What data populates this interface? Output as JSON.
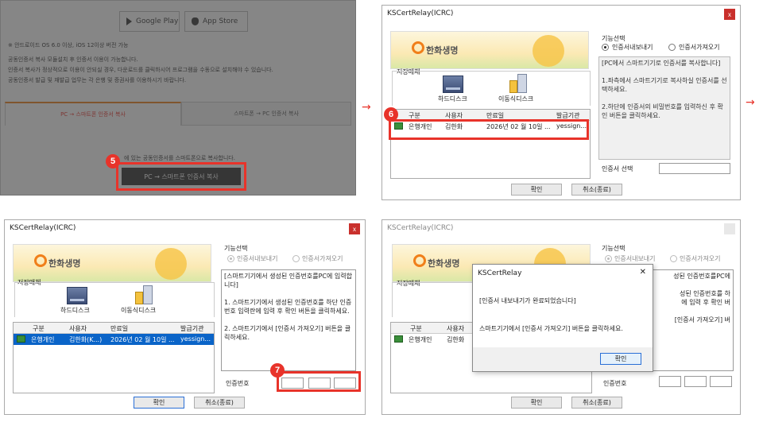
{
  "panel1": {
    "store_buttons": [
      "Google Play",
      "App Store"
    ],
    "os_note": "※ 안드로이드 OS 6.0 이상, iOS 12이상 버전 가능",
    "notes": [
      "공동인증서 복사 모듈설치 후 인증서 이용이 가능합니다.",
      "인증서 복사가 정상적으로 이용이 안되실 경우, 다운로드를 클릭하시어 프로그램을 수동으로 설치해야 수 있습니다.",
      "공동인증서 발급 및 재발급 업무는 각 은행 및 증권사를 이용하시기 바랍니다."
    ],
    "tab_pc_to_phone": "PC → 스마트폰 인증서 복사",
    "tab_phone_to_pc": "스마트폰 → PC 인증서 복사",
    "desc": "에 있는 공동인증서를 스마트폰으로 복사합니다.",
    "copy_button": "PC → 스마트폰 인증서 복사",
    "step": "5"
  },
  "win2": {
    "title": "KSCertRelay(ICRC)",
    "close": "x",
    "logo": "한화생명",
    "storage_label": "저장매체",
    "hdd": "하드디스크",
    "usb": "이동식디스크",
    "table_headers": [
      "구분",
      "사용자",
      "만료일",
      "발급기관"
    ],
    "row": [
      "은행개인",
      "김한화",
      "2026년 02 월 10일 ...",
      "yessign..."
    ],
    "func_label": "기능선택",
    "radio_export": "인증서내보내기",
    "radio_import": "인증서가져오기",
    "instructions": "[PC에서 스마트기기로 인증서를 복사합니다]\n\n1.좌측에서 스마트기기로 복사하실 인증서를 선택하세요.\n\n2.하단에 인증서의 비밀번호를 입력하신 후 확인 버튼을 클릭하세요.",
    "cert_select_label": "인증서 선택",
    "ok": "확인",
    "cancel": "취소(종료)",
    "step": "6"
  },
  "win3": {
    "title": "KSCertRelay(ICRC)",
    "close": "x",
    "logo": "한화생명",
    "storage_label": "저장매체",
    "hdd": "하드디스크",
    "usb": "이동식디스크",
    "table_headers": [
      "구분",
      "사용자",
      "만료일",
      "발급기관"
    ],
    "row": [
      "은행개인",
      "김한화(K...)",
      "2026년 02 월 10일 ...",
      "yessign..."
    ],
    "func_label": "기능선택",
    "radio_export": "인증서내보내기",
    "radio_import": "인증서가져오기",
    "instructions": "[스마트기기에서 생성된 인증번호를PC에 입력합니다]\n\n1. 스마트기기에서 생성된 인증번호를 하단 인증번호 입력란에 입력 후 확인 버튼을 클릭하세요.\n\n2. 스마트기기에서 [인증서 가져오기] 버튼을 클릭하세요.",
    "auth_label": "인증번호",
    "ok": "확인",
    "cancel": "취소(종료)",
    "step": "7"
  },
  "win4": {
    "title": "KSCertRelay(ICRC)",
    "logo": "한화생명",
    "storage_label": "저장매체",
    "table_headers": [
      "구분",
      "사용자"
    ],
    "row": [
      "은행개인",
      "김한화"
    ],
    "func_label": "기능선택",
    "radio_export": "인증서내보내기",
    "radio_import": "인증서가져오기",
    "instructions": "성된 인증번호를PC에\n\n성된 인증번호를 하\n에 입력 후 확인 버\n\n[인증서 가져오기] 버",
    "auth_label": "인증번호",
    "ok": "확인",
    "cancel": "취소(종료)",
    "msgbox": {
      "title": "KSCertRelay",
      "close": "✕",
      "line1": "[인증서 내보내기가 완료되었습니다]",
      "line2": "스마트기기에서 [인증서 가져오기] 버튼을 클릭하세요.",
      "ok": "확인"
    }
  },
  "arrow": "→"
}
